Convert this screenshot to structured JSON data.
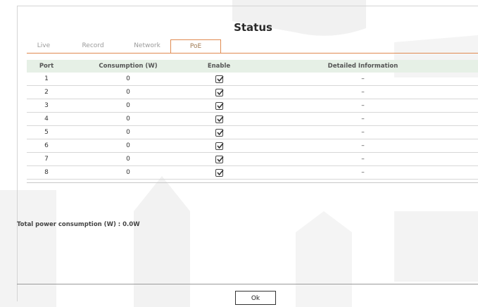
{
  "dialog": {
    "title": "Status"
  },
  "tabs": [
    {
      "label": "Live",
      "active": false
    },
    {
      "label": "Record",
      "active": false
    },
    {
      "label": "Network",
      "active": false
    },
    {
      "label": "PoE",
      "active": true
    }
  ],
  "table": {
    "headers": {
      "port": "Port",
      "consumption": "Consumption (W)",
      "enable": "Enable",
      "detail": "Detailed Information"
    },
    "rows": [
      {
        "port": "1",
        "consumption": "0",
        "enabled": true,
        "detail": "–"
      },
      {
        "port": "2",
        "consumption": "0",
        "enabled": true,
        "detail": "–"
      },
      {
        "port": "3",
        "consumption": "0",
        "enabled": true,
        "detail": "–"
      },
      {
        "port": "4",
        "consumption": "0",
        "enabled": true,
        "detail": "–"
      },
      {
        "port": "5",
        "consumption": "0",
        "enabled": true,
        "detail": "–"
      },
      {
        "port": "6",
        "consumption": "0",
        "enabled": true,
        "detail": "–"
      },
      {
        "port": "7",
        "consumption": "0",
        "enabled": true,
        "detail": "–"
      },
      {
        "port": "8",
        "consumption": "0",
        "enabled": true,
        "detail": "–"
      }
    ]
  },
  "summary": {
    "total_power": "Total power consumption (W) : 0.0W"
  },
  "footer": {
    "ok_label": "Ok"
  },
  "colors": {
    "accent": "#e08a50",
    "header_bg": "#e6f0e6"
  }
}
